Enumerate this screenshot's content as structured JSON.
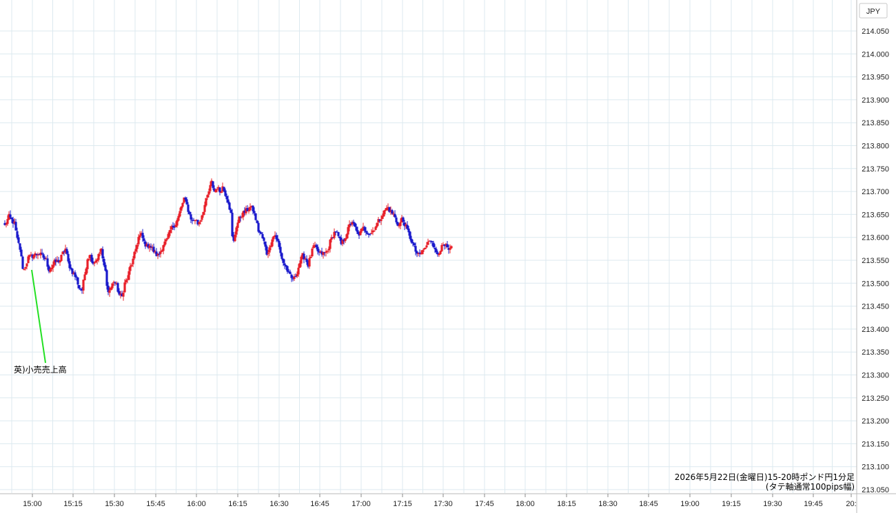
{
  "chart_data": {
    "type": "candlestick",
    "currency": "JPY",
    "y_ticks": [
      "214.050",
      "214.000",
      "213.950",
      "213.900",
      "213.850",
      "213.800",
      "213.750",
      "213.700",
      "213.650",
      "213.600",
      "213.550",
      "213.500",
      "213.450",
      "213.400",
      "213.350",
      "213.300",
      "213.250",
      "213.200",
      "213.150",
      "213.100",
      "213.050"
    ],
    "ylim": [
      213.03,
      214.07
    ],
    "x_ticks": [
      "15:00",
      "15:15",
      "15:30",
      "15:45",
      "16:00",
      "16:15",
      "16:30",
      "16:45",
      "17:00",
      "17:15",
      "17:30",
      "17:45",
      "18:00",
      "18:15",
      "18:30",
      "18:45",
      "19:00",
      "19:15",
      "19:30",
      "19:45",
      "20:"
    ],
    "caption_line1": "2026年5月22日(金曜日)15-20時ポンド円1分足",
    "caption_line2": "(タテ軸通常100pips幅)",
    "annotation": {
      "text": "英)小売売上高",
      "time": "15:00"
    },
    "colors": {
      "up": "#e8202a",
      "down": "#1a1acc",
      "grid": "#dce9ef",
      "annotation_line": "#22e022"
    },
    "anchors_close": [
      [
        0,
        213.625
      ],
      [
        3,
        213.645
      ],
      [
        7,
        213.63
      ],
      [
        9,
        213.595
      ],
      [
        11,
        213.575
      ],
      [
        13,
        213.535
      ],
      [
        14,
        213.53
      ],
      [
        17,
        213.555
      ],
      [
        20,
        213.56
      ],
      [
        24,
        213.565
      ],
      [
        27,
        213.56
      ],
      [
        30,
        213.55
      ],
      [
        32,
        213.53
      ],
      [
        34,
        213.535
      ],
      [
        36,
        213.545
      ],
      [
        40,
        213.55
      ],
      [
        42,
        213.565
      ],
      [
        44,
        213.575
      ],
      [
        46,
        213.545
      ],
      [
        48,
        213.53
      ],
      [
        50,
        213.52
      ],
      [
        52,
        213.51
      ],
      [
        54,
        213.49
      ],
      [
        56,
        213.485
      ],
      [
        58,
        213.52
      ],
      [
        60,
        213.555
      ],
      [
        62,
        213.56
      ],
      [
        64,
        213.545
      ],
      [
        66,
        213.55
      ],
      [
        68,
        213.56
      ],
      [
        70,
        213.575
      ],
      [
        71,
        213.55
      ],
      [
        73,
        213.525
      ],
      [
        74,
        213.5
      ],
      [
        75,
        213.48
      ],
      [
        77,
        213.49
      ],
      [
        79,
        213.505
      ],
      [
        81,
        213.495
      ],
      [
        83,
        213.475
      ],
      [
        85,
        213.47
      ],
      [
        87,
        213.5
      ],
      [
        89,
        213.51
      ],
      [
        91,
        213.535
      ],
      [
        93,
        213.55
      ],
      [
        95,
        213.575
      ],
      [
        97,
        213.6
      ],
      [
        99,
        213.605
      ],
      [
        101,
        213.59
      ],
      [
        103,
        213.58
      ],
      [
        105,
        213.585
      ],
      [
        107,
        213.575
      ],
      [
        109,
        213.565
      ],
      [
        111,
        213.56
      ],
      [
        113,
        213.57
      ],
      [
        115,
        213.585
      ],
      [
        118,
        213.595
      ],
      [
        120,
        213.615
      ],
      [
        122,
        213.625
      ],
      [
        124,
        213.63
      ],
      [
        126,
        213.645
      ],
      [
        128,
        213.665
      ],
      [
        130,
        213.685
      ],
      [
        132,
        213.67
      ],
      [
        134,
        213.65
      ],
      [
        136,
        213.635
      ],
      [
        138,
        213.64
      ],
      [
        140,
        213.63
      ],
      [
        142,
        213.64
      ],
      [
        144,
        213.66
      ],
      [
        146,
        213.68
      ],
      [
        148,
        213.7
      ],
      [
        150,
        213.72
      ],
      [
        152,
        213.7
      ],
      [
        154,
        213.71
      ],
      [
        156,
        213.7
      ],
      [
        158,
        213.71
      ],
      [
        160,
        213.695
      ],
      [
        162,
        213.68
      ],
      [
        164,
        213.65
      ],
      [
        165,
        213.6
      ],
      [
        166,
        213.59
      ],
      [
        168,
        213.625
      ],
      [
        170,
        213.64
      ],
      [
        172,
        213.65
      ],
      [
        174,
        213.655
      ],
      [
        176,
        213.66
      ],
      [
        178,
        213.665
      ],
      [
        180,
        213.66
      ],
      [
        182,
        213.64
      ],
      [
        184,
        213.615
      ],
      [
        186,
        213.605
      ],
      [
        188,
        213.59
      ],
      [
        190,
        213.565
      ],
      [
        192,
        213.575
      ],
      [
        194,
        213.6
      ],
      [
        196,
        213.605
      ],
      [
        198,
        213.59
      ],
      [
        200,
        213.565
      ],
      [
        202,
        213.545
      ],
      [
        204,
        213.535
      ],
      [
        206,
        213.52
      ],
      [
        208,
        213.51
      ],
      [
        210,
        213.51
      ],
      [
        212,
        213.525
      ],
      [
        214,
        213.545
      ],
      [
        216,
        213.56
      ],
      [
        218,
        213.555
      ],
      [
        220,
        213.54
      ],
      [
        222,
        213.56
      ],
      [
        224,
        213.58
      ],
      [
        226,
        213.575
      ],
      [
        228,
        213.565
      ],
      [
        230,
        213.565
      ],
      [
        232,
        213.565
      ],
      [
        234,
        213.57
      ],
      [
        236,
        213.59
      ],
      [
        238,
        213.605
      ],
      [
        240,
        213.615
      ],
      [
        242,
        213.6
      ],
      [
        244,
        213.585
      ],
      [
        246,
        213.595
      ],
      [
        248,
        213.61
      ],
      [
        250,
        213.625
      ],
      [
        252,
        213.635
      ],
      [
        254,
        213.62
      ],
      [
        256,
        213.605
      ],
      [
        258,
        213.61
      ],
      [
        260,
        213.62
      ],
      [
        262,
        213.615
      ],
      [
        264,
        213.61
      ],
      [
        266,
        213.61
      ],
      [
        268,
        213.62
      ],
      [
        270,
        213.63
      ],
      [
        272,
        213.64
      ],
      [
        274,
        213.65
      ],
      [
        276,
        213.66
      ],
      [
        278,
        213.665
      ],
      [
        280,
        213.655
      ],
      [
        282,
        213.65
      ],
      [
        284,
        213.635
      ],
      [
        286,
        213.625
      ],
      [
        288,
        213.64
      ],
      [
        290,
        213.63
      ],
      [
        292,
        213.615
      ],
      [
        294,
        213.6
      ],
      [
        296,
        213.585
      ],
      [
        298,
        213.57
      ],
      [
        300,
        213.56
      ],
      [
        302,
        213.565
      ],
      [
        304,
        213.575
      ],
      [
        306,
        213.58
      ],
      [
        308,
        213.595
      ],
      [
        310,
        213.595
      ],
      [
        312,
        213.57
      ],
      [
        314,
        213.565
      ],
      [
        316,
        213.575
      ],
      [
        318,
        213.58
      ],
      [
        320,
        213.58
      ],
      [
        322,
        213.57
      ],
      [
        324,
        213.575
      ]
    ]
  }
}
